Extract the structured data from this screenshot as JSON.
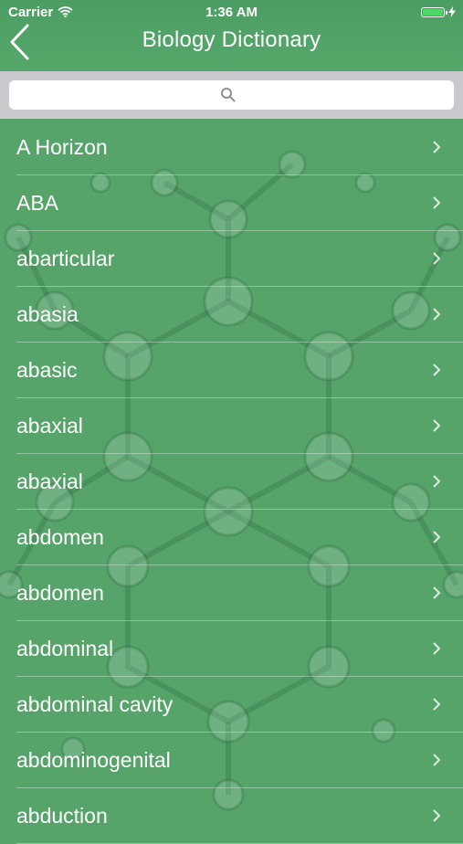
{
  "status_bar": {
    "carrier": "Carrier",
    "time": "1:36 AM",
    "wifi_icon": "wifi-icon",
    "battery_icon": "battery-icon",
    "charging_icon": "bolt-icon"
  },
  "nav": {
    "title": "Biology Dictionary",
    "back_icon": "chevron-left-icon"
  },
  "search": {
    "placeholder": "",
    "value": "",
    "icon": "search-icon"
  },
  "list": {
    "items": [
      {
        "label": "A Horizon"
      },
      {
        "label": "ABA"
      },
      {
        "label": "abarticular"
      },
      {
        "label": "abasia"
      },
      {
        "label": "abasic"
      },
      {
        "label": "abaxial"
      },
      {
        "label": "abaxial"
      },
      {
        "label": "abdomen"
      },
      {
        "label": "abdomen"
      },
      {
        "label": "abdominal"
      },
      {
        "label": "abdominal cavity"
      },
      {
        "label": "abdominogenital"
      },
      {
        "label": "abduction"
      }
    ],
    "row_icon": "chevron-right-icon"
  },
  "colors": {
    "background": "#57a46b",
    "nav": "#4c9d63",
    "search_bar": "#c9c9ce",
    "text": "#ffffff",
    "battery": "#4cd964"
  }
}
